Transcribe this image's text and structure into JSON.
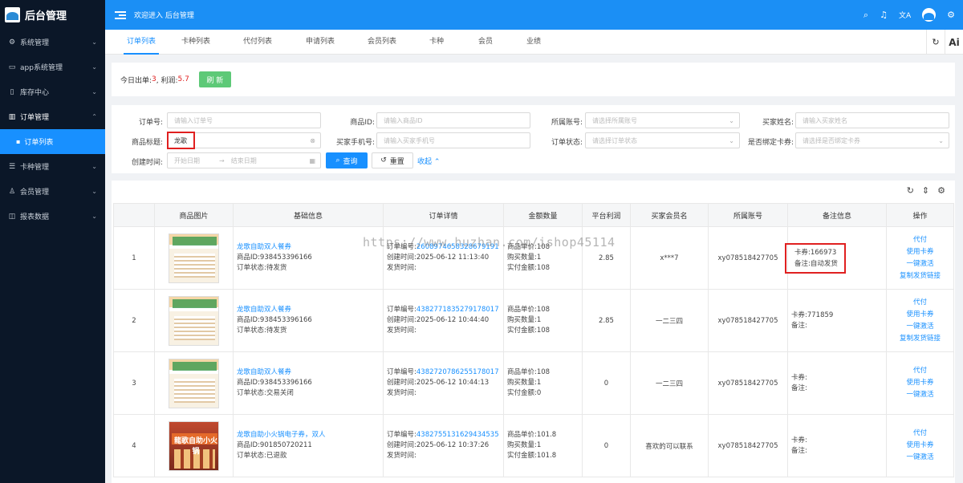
{
  "sidebar": {
    "logo": "后台管理",
    "items": [
      {
        "label": "系统管理",
        "icon": "gear-icon"
      },
      {
        "label": "app系统管理",
        "icon": "monitor-icon"
      },
      {
        "label": "库存中心",
        "icon": "document-icon"
      },
      {
        "label": "订单管理",
        "icon": "chart-icon"
      },
      {
        "label": "卡种管理",
        "icon": "list-icon"
      },
      {
        "label": "会员管理",
        "icon": "user-icon"
      },
      {
        "label": "报表数据",
        "icon": "report-icon"
      }
    ],
    "subitem": "订单列表"
  },
  "header": {
    "welcome": "欢迎进入 后台管理",
    "icons": [
      "search-icon",
      "bell-icon",
      "translate-icon",
      "avatar",
      "settings-icon"
    ]
  },
  "tabs": [
    "订单列表",
    "卡种列表",
    "代付列表",
    "申请列表",
    "会员列表",
    "卡种",
    "会员",
    "业绩"
  ],
  "stats": {
    "prefix": "今日出单:",
    "orders": "3",
    "mid": ", 利润:",
    "profit": "5.7",
    "refresh": "刷 新"
  },
  "filters": {
    "order_no": {
      "label": "订单号:",
      "placeholder": "请输入订单号"
    },
    "product_id": {
      "label": "商品ID:",
      "placeholder": "请输入商品ID"
    },
    "account": {
      "label": "所属账号:",
      "placeholder": "请选择所属账号"
    },
    "buyer_name": {
      "label": "买家姓名:",
      "placeholder": "请输入买家姓名"
    },
    "product_title": {
      "label": "商品标题:",
      "value": "龙歌"
    },
    "buyer_phone": {
      "label": "买家手机号:",
      "placeholder": "请输入买家手机号"
    },
    "order_status": {
      "label": "订单状态:",
      "placeholder": "请选择订单状态"
    },
    "bind_card": {
      "label": "是否绑定卡券:",
      "placeholder": "请选择是否绑定卡券"
    },
    "created": {
      "label": "创建时间:",
      "start": "开始日期",
      "end": "结束日期"
    },
    "query": "查询",
    "reset": "重置",
    "collapse": "收起"
  },
  "table": {
    "headers": [
      "",
      "商品图片",
      "基础信息",
      "订单详情",
      "金额数量",
      "平台利润",
      "买家会员名",
      "所属账号",
      "备注信息",
      "操作"
    ],
    "rows": [
      {
        "index": "1",
        "title": "龙歌自助双人餐券",
        "product_id": "商品ID:938453396166",
        "status": "订单状态:待发货",
        "order_label": "订单编号:",
        "order_no": "2608974658328679191",
        "created": "创建时间:2025-06-12 11:13:40",
        "shipped": "发货时间:",
        "unit_price": "商品单价:108",
        "qty": "购买数量:1",
        "paid": "实付金额:108",
        "profit": "2.85",
        "buyer": "x***7",
        "account": "xy078518427705",
        "card": "卡券:166973",
        "note": "备注:自动发货",
        "ops": [
          "代付",
          "使用卡券",
          "一键激活",
          "复制发货链接"
        ]
      },
      {
        "index": "2",
        "title": "龙歌自助双人餐券",
        "product_id": "商品ID:938453396166",
        "status": "订单状态:待发货",
        "order_label": "订单编号:",
        "order_no": "4382771835279178017",
        "created": "创建时间:2025-06-12 10:44:40",
        "shipped": "发货时间:",
        "unit_price": "商品单价:108",
        "qty": "购买数量:1",
        "paid": "实付金额:108",
        "profit": "2.85",
        "buyer": "一二三四",
        "account": "xy078518427705",
        "card": "卡券:771859",
        "note": "备注:",
        "ops": [
          "代付",
          "使用卡券",
          "一键激活",
          "复制发货链接"
        ]
      },
      {
        "index": "3",
        "title": "龙歌自助双人餐券",
        "product_id": "商品ID:938453396166",
        "status": "订单状态:交易关闭",
        "order_label": "订单编号:",
        "order_no": "4382720786255178017",
        "created": "创建时间:2025-06-12 10:44:13",
        "shipped": "发货时间:",
        "unit_price": "商品单价:108",
        "qty": "购买数量:1",
        "paid": "实付金额:0",
        "profit": "0",
        "buyer": "一二三四",
        "account": "xy078518427705",
        "card": "卡券:",
        "note": "备注:",
        "ops": [
          "代付",
          "使用卡券",
          "一键激活"
        ]
      },
      {
        "index": "4",
        "title": "龙歌自助小火锅电子券，双人",
        "product_id": "商品ID:901850720211",
        "status": "订单状态:已退款",
        "order_label": "订单编号:",
        "order_no": "4382755131629434535",
        "created": "创建时间:2025-06-12 10:37:26",
        "shipped": "发货时间:",
        "unit_price": "商品单价:101.8",
        "qty": "购买数量:1",
        "paid": "实付金额:101.8",
        "profit": "0",
        "buyer": "喜欢的可以联系",
        "account": "xy078518427705",
        "card": "卡券:",
        "note": "备注:",
        "ops": [
          "代付",
          "使用卡券",
          "一键激活"
        ]
      }
    ],
    "hotpot_label": "龍歌自助小火锅"
  },
  "watermark": "https://www.huzhan.com/ishop45114"
}
